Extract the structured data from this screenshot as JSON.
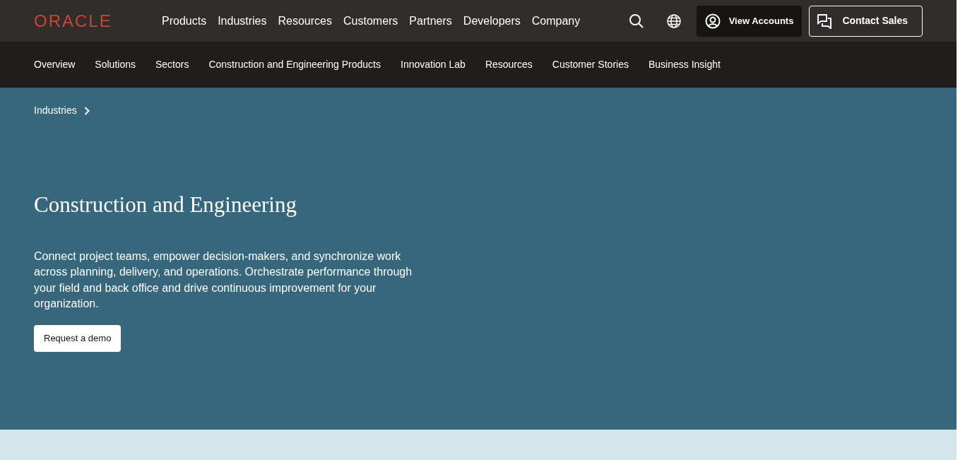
{
  "header": {
    "logo": "ORACLE",
    "nav": [
      "Products",
      "Industries",
      "Resources",
      "Customers",
      "Partners",
      "Developers",
      "Company"
    ],
    "view_accounts": "View Accounts",
    "contact_sales": "Contact Sales"
  },
  "subnav": [
    "Overview",
    "Solutions",
    "Sectors",
    "Construction and Engineering Products",
    "Innovation Lab",
    "Resources",
    "Customer Stories",
    "Business Insight"
  ],
  "hero": {
    "breadcrumb": "Industries",
    "title": "Construction and Engineering",
    "description": "Connect project teams, empower decision-makers, and synchronize work across planning, delivery, and operations. Orchestrate performance through your field and back office and drive continuous improvement for your organization.",
    "button": "Request a demo"
  }
}
